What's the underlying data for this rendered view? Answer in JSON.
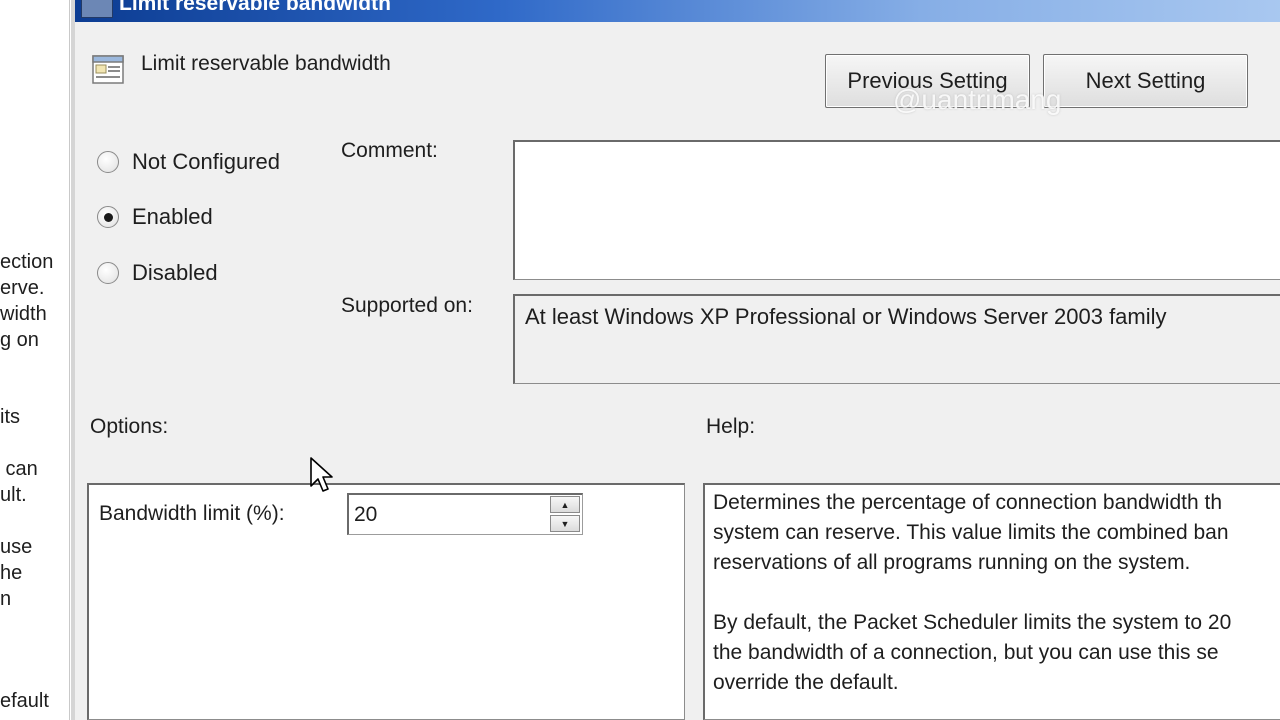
{
  "window": {
    "title": "Limit reservable bandwidth"
  },
  "background_text": [
    "ection",
    "erve.",
    "width",
    "g on",
    "its",
    " can",
    "ult.",
    "use",
    "he",
    "n",
    "efault"
  ],
  "heading": {
    "title": "Limit reservable bandwidth",
    "icon": "policy-setting-icon"
  },
  "nav": {
    "previous_label": "Previous Setting",
    "next_label": "Next Setting"
  },
  "watermark": "@uantrimang",
  "state": {
    "options": [
      {
        "label": "Not Configured",
        "checked": false
      },
      {
        "label": "Enabled",
        "checked": true
      },
      {
        "label": "Disabled",
        "checked": false
      }
    ]
  },
  "comment": {
    "label": "Comment:",
    "value": ""
  },
  "supported": {
    "label": "Supported on:",
    "value": "At least Windows XP Professional or Windows Server 2003 family"
  },
  "options_section": {
    "label": "Options:",
    "bandwidth_label": "Bandwidth limit (%):",
    "bandwidth_value": "20"
  },
  "help": {
    "label": "Help:",
    "lines": [
      "Determines the percentage of connection bandwidth th",
      "system can reserve. This value limits the combined ban",
      "reservations of all programs running on the system.",
      "",
      "By default, the Packet Scheduler limits the system to 20",
      "the bandwidth of a connection, but you can use this se",
      "override the default."
    ]
  }
}
